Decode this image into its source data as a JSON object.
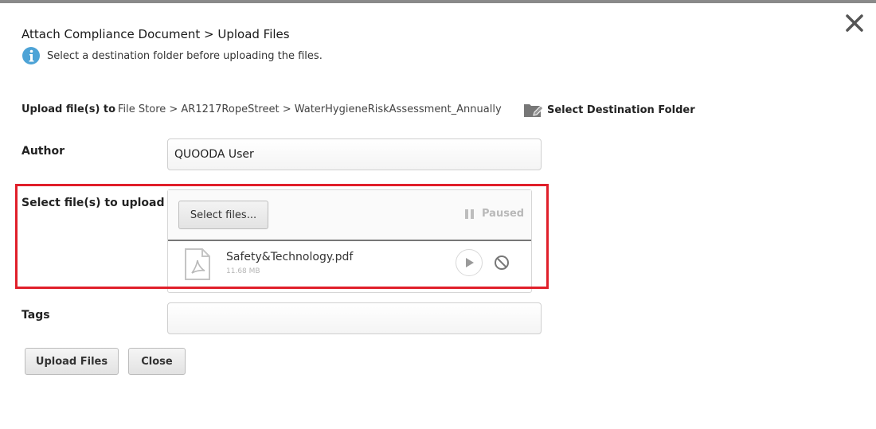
{
  "dialog": {
    "title": "Attach Compliance Document > Upload Files",
    "info_message": "Select a destination folder before uploading the files."
  },
  "destination": {
    "label": "Upload file(s) to",
    "path": "File Store > AR1217RopeStreet > WaterHygieneRiskAssessment_Annually",
    "select_button": "Select Destination Folder"
  },
  "author": {
    "label": "Author",
    "value": "QUOODA User"
  },
  "upload": {
    "label": "Select file(s) to upload",
    "select_button": "Select files...",
    "status": "Paused",
    "files": [
      {
        "name": "Safety&Technology.pdf",
        "size": "11.68 MB"
      }
    ]
  },
  "tags": {
    "label": "Tags",
    "value": ""
  },
  "actions": {
    "upload_label": "Upload Files",
    "close_label": "Close"
  },
  "colors": {
    "highlight": "#e01f2a",
    "info": "#4da3d6"
  },
  "icons": [
    "close-icon",
    "info-icon",
    "folder-edit-icon",
    "pause-icon",
    "pdf-file-icon",
    "play-icon",
    "cancel-icon"
  ]
}
